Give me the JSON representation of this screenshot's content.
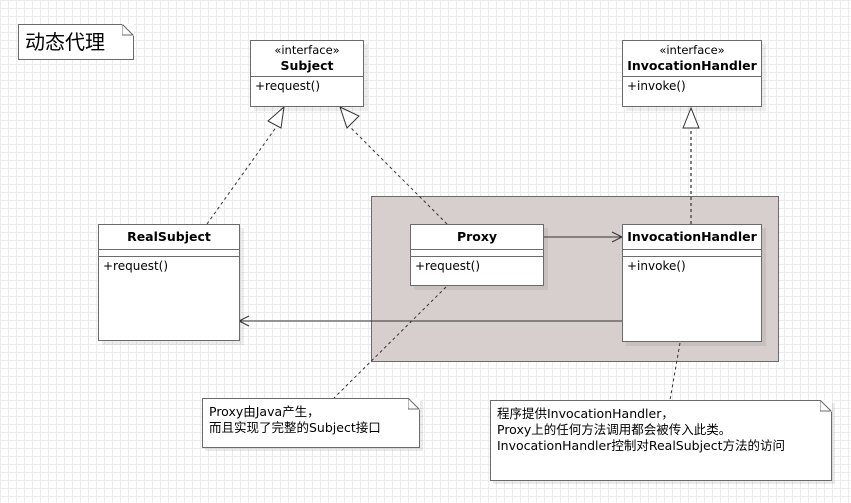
{
  "title_note": {
    "text": "动态代理"
  },
  "classes": {
    "subject": {
      "stereotype": "«interface»",
      "name": "Subject",
      "operation": "+request()"
    },
    "handler_interface": {
      "stereotype": "«interface»",
      "name": "InvocationHandler",
      "operation": "+invoke()"
    },
    "real_subject": {
      "name": "RealSubject",
      "operation": "+request()"
    },
    "proxy": {
      "name": "Proxy",
      "operation": "+request()"
    },
    "handler_impl": {
      "name": "InvocationHandler",
      "operation": "+invoke()"
    }
  },
  "notes": {
    "proxy_note": {
      "text": "Proxy由Java产生，\n而且实现了完整的Subject接口"
    },
    "handler_note": {
      "text": "程序提供InvocationHandler，\nProxy上的任何方法调用都会被传入此类。\nInvocationHandler控制对RealSubject方法的访问"
    }
  },
  "colors": {
    "package_fill": "#d7cfcd",
    "border": "#6b6b6b",
    "grid": "#ececec"
  }
}
